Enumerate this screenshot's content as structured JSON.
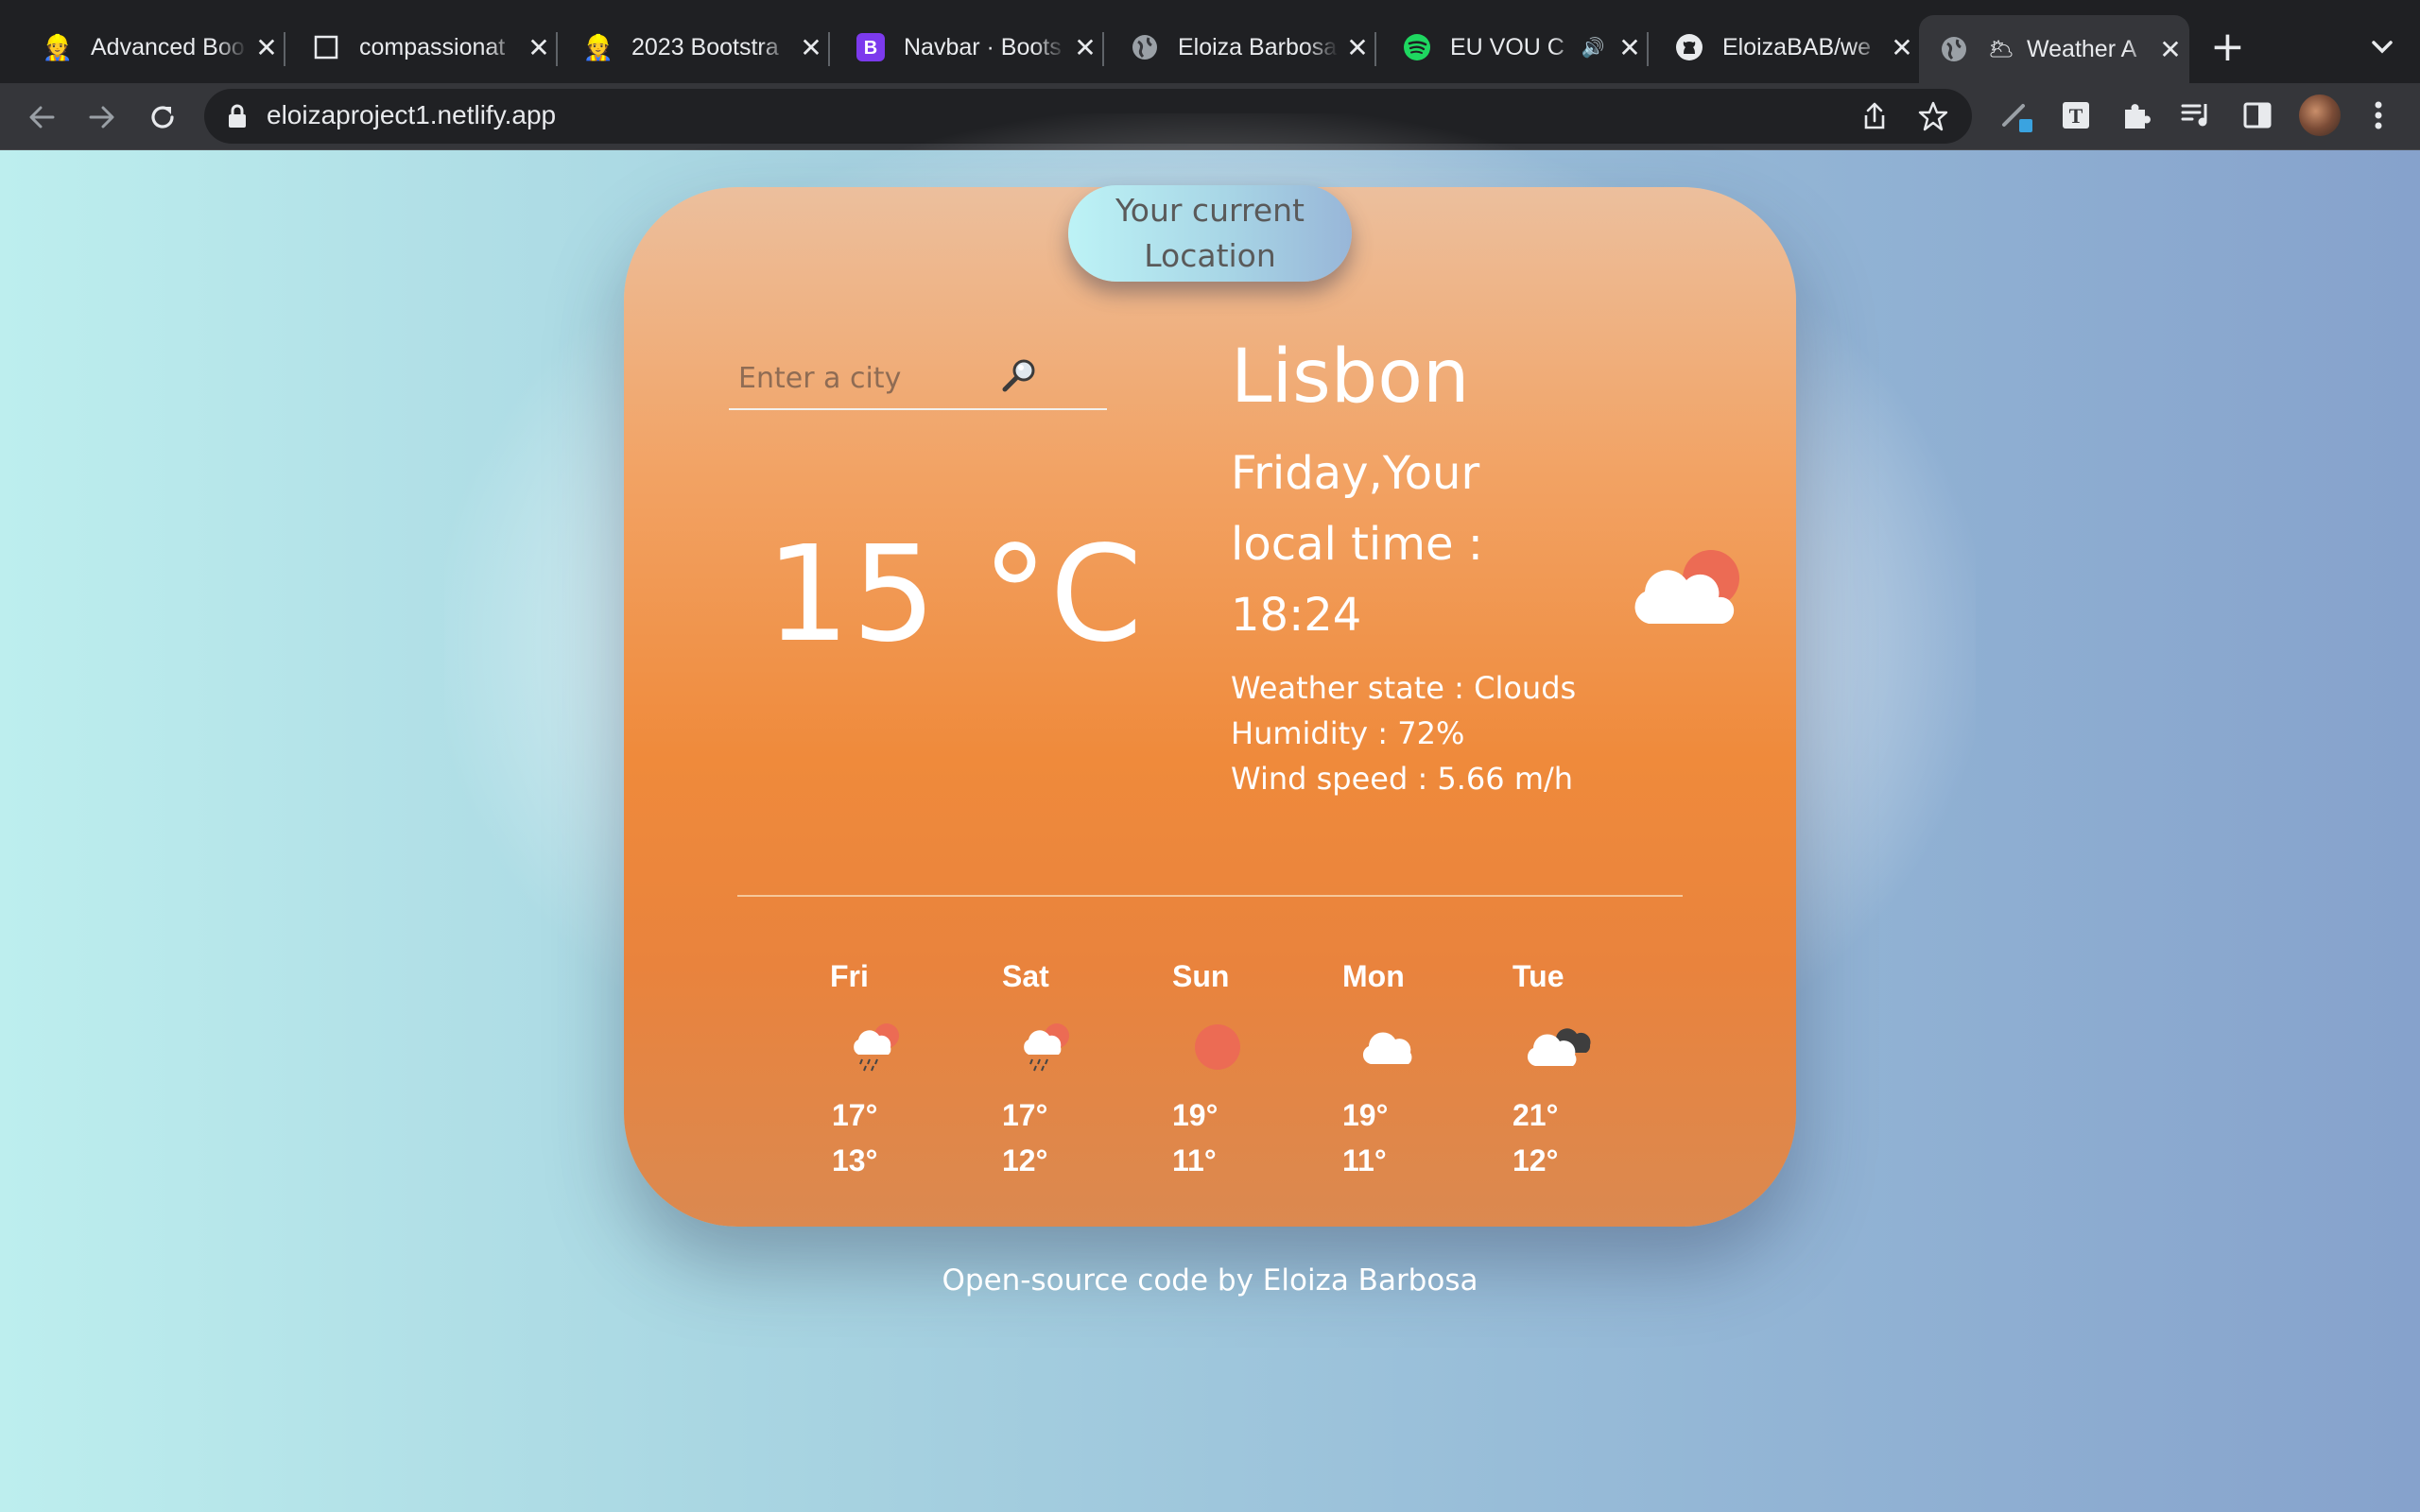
{
  "browser": {
    "tabs": [
      {
        "title": "Advanced Boo",
        "favicon": "user-emoji-icon"
      },
      {
        "title": "compassionat",
        "favicon": "blank-page-icon"
      },
      {
        "title": "2023 Bootstra",
        "favicon": "user-emoji-icon"
      },
      {
        "title": "Navbar · Boots",
        "favicon": "bootstrap-icon"
      },
      {
        "title": "Eloiza Barbosa",
        "favicon": "globe-icon"
      },
      {
        "title": "EU VOU C",
        "favicon": "spotify-icon"
      },
      {
        "title": "EloizaBAB/we",
        "favicon": "github-icon"
      },
      {
        "title": "Weather A",
        "favicon": "globe-icon",
        "active": true
      }
    ],
    "new_tab": "+",
    "url": "eloizaproject1.netlify.app"
  },
  "weather": {
    "location_button": "Your current Location",
    "search_placeholder": "Enter a city",
    "search_icon": "🔎",
    "temperature": "15 °C",
    "city": "Lisbon",
    "date_time": "Friday,Your local time : 18:24",
    "state": "Weather state : Clouds",
    "humidity": "Humidity : 72%",
    "wind": "Wind speed : 5.66 m/h",
    "icon": "cloud-sun-icon"
  },
  "forecast": [
    {
      "day": "Fri",
      "max": "17°",
      "min": "13°",
      "icon": "rain-cloud-icon"
    },
    {
      "day": "Sat",
      "max": "17°",
      "min": "12°",
      "icon": "rain-cloud-icon"
    },
    {
      "day": "Sun",
      "max": "19°",
      "min": "11°",
      "icon": "sun-icon"
    },
    {
      "day": "Mon",
      "max": "19°",
      "min": "11°",
      "icon": "cloud-icon"
    },
    {
      "day": "Tue",
      "max": "21°",
      "min": "12°",
      "icon": "dark-cloud-icon"
    }
  ],
  "footer": {
    "text": "Open-source code by Eloiza Barbosa"
  },
  "colors": {
    "card_top": "#ecbf9d",
    "card_mid": "#ef8a3b",
    "accent_sun": "#ec6b54",
    "chrome_bg": "#1f2023"
  }
}
